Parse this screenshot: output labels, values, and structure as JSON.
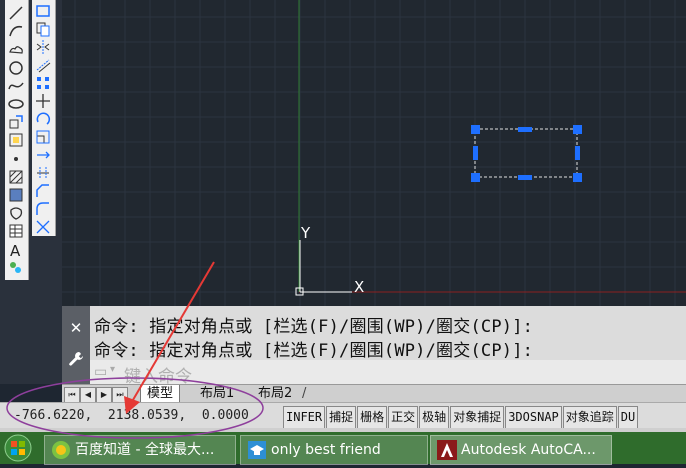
{
  "canvas": {
    "colors": {
      "background": "#212830",
      "grid": "#2c3440",
      "selection": "#1e6fff",
      "y_axis": "#2e7d32",
      "x_axis": "#c62828"
    },
    "ucs": {
      "x_label": "X",
      "y_label": "Y"
    }
  },
  "left_toolbar": {
    "column1": [
      "line-icon",
      "arc-icon",
      "revision-cloud-icon",
      "circle-icon",
      "spline-icon",
      "ellipse-icon",
      "block-insert-icon",
      "make-block-icon",
      "point-icon",
      "hatch-icon",
      "gradient-icon",
      "region-icon",
      "table-icon",
      "mtext-icon",
      "add-selected-icon"
    ],
    "column2": [
      "rectangle-icon",
      "copy-icon",
      "mirror-icon",
      "offset-icon",
      "array-icon",
      "move-icon",
      "rotate-icon",
      "scale-icon",
      "stretch-icon",
      "trim-icon",
      "chamfer-icon",
      "fillet-icon",
      "explode-icon"
    ]
  },
  "command": {
    "history": [
      "命令: 指定对角点或 [栏选(F)/圈围(WP)/圈交(CP)]:",
      "命令: 指定对角点或 [栏选(F)/圈围(WP)/圈交(CP)]:"
    ],
    "placeholder": "键入命令"
  },
  "layout_tabs": {
    "tabs": [
      "模型",
      "布局1",
      "布局2"
    ]
  },
  "status_bar": {
    "coordinates": "-766.6220,  2138.0539,  0.0000",
    "toggles": [
      "INFER",
      "捕捉",
      "栅格",
      "正交",
      "极轴",
      "对象捕捉",
      "3DOSNAP",
      "对象追踪",
      "DU"
    ]
  },
  "taskbar": {
    "items": [
      {
        "label": "百度知道 - 全球最大...",
        "icon": "browser-icon"
      },
      {
        "label": "only best friend",
        "icon": "graduation-cap-icon"
      },
      {
        "label": "Autodesk AutoCA...",
        "icon": "autocad-icon"
      }
    ]
  },
  "annotation": {
    "color": "#e53935",
    "ellipse_color": "#8e3f9c"
  }
}
